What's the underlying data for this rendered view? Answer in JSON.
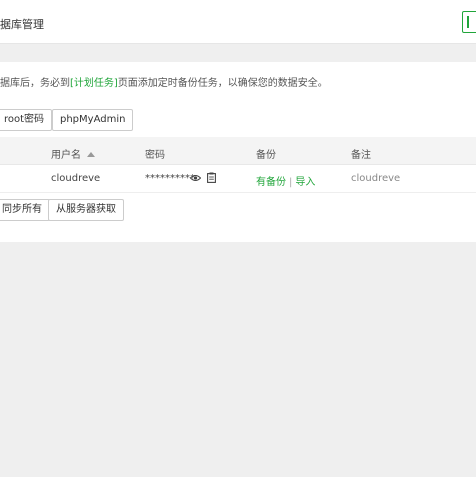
{
  "header": {
    "title": "据库管理"
  },
  "notice": {
    "prefix": "据库后，务必到",
    "link": "[计划任务]",
    "suffix": "页面添加定时备份任务，以确保您的数据安全。"
  },
  "toolbar": {
    "root_password": "root密码",
    "phpmyadmin": "phpMyAdmin"
  },
  "table": {
    "columns": {
      "username": "用户名",
      "password": "密码",
      "backup": "备份",
      "note": "备注"
    },
    "rows": [
      {
        "username": "cloudreve",
        "password": "**********",
        "backup_status": "有备份",
        "separator": "|",
        "import_label": "导入",
        "note": "cloudreve"
      }
    ]
  },
  "actions": {
    "sync_all": "同步所有",
    "fetch_server": "从服务器获取"
  },
  "colors": {
    "accent": "#20a53a"
  },
  "icons": [
    "eye-icon",
    "copy-icon",
    "sort-asc-icon"
  ]
}
